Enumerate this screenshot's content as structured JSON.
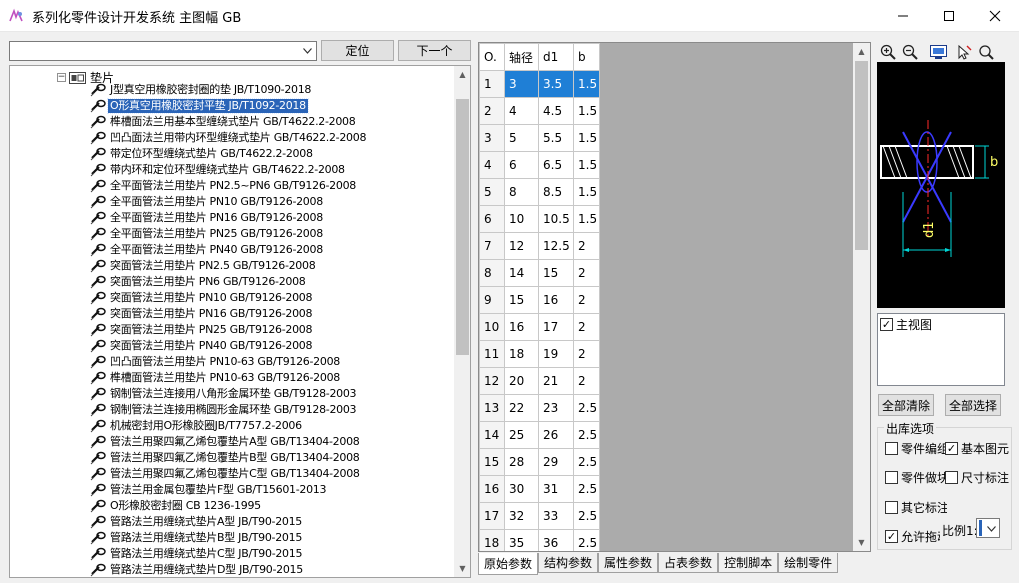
{
  "window": {
    "title": "系列化零件设计开发系统 主图幅 GB"
  },
  "search": {
    "value": "",
    "locate_label": "定位",
    "next_label": "下一个"
  },
  "tree": {
    "root_label": "垫片",
    "items": [
      "J型真空用橡胶密封圈的垫 JB/T1090-2018",
      "O形真空用橡胶密封平垫 JB/T1092-2018",
      "榫槽面法兰用基本型缠绕式垫片 GB/T4622.2-2008",
      "凹凸面法兰用带内环型缠绕式垫片 GB/T4622.2-2008",
      "带定位环型缠绕式垫片 GB/T4622.2-2008",
      "带内环和定位环型缠绕式垫片 GB/T4622.2-2008",
      "全平面管法兰用垫片 PN2.5~PN6  GB/T9126-2008",
      "全平面管法兰用垫片 PN10 GB/T9126-2008",
      "全平面管法兰用垫片 PN16 GB/T9126-2008",
      "全平面管法兰用垫片 PN25  GB/T9126-2008",
      "全平面管法兰用垫片 PN40  GB/T9126-2008",
      "突面管法兰用垫片 PN2.5  GB/T9126-2008",
      "突面管法兰用垫片 PN6 GB/T9126-2008",
      "突面管法兰用垫片 PN10  GB/T9126-2008",
      "突面管法兰用垫片 PN16  GB/T9126-2008",
      "突面管法兰用垫片 PN25 GB/T9126-2008",
      "突面管法兰用垫片 PN40 GB/T9126-2008",
      "凹凸面管法兰用垫片 PN10-63  GB/T9126-2008",
      "榫槽面管法兰用垫片 PN10-63 GB/T9126-2008",
      "钢制管法兰连接用八角形金属环垫 GB/T9128-2003",
      "钢制管法兰连接用椭圆形金属环垫 GB/T9128-2003",
      "机械密封用O形橡胶圈JB/T7757.2-2006",
      "管法兰用聚四氟乙烯包覆垫片A型  GB/T13404-2008",
      "管法兰用聚四氟乙烯包覆垫片B型  GB/T13404-2008",
      "管法兰用聚四氟乙烯包覆垫片C型  GB/T13404-2008",
      "管法兰用金属包覆垫片F型  GB/T15601-2013",
      "O形橡胶密封圈 CB 1236-1995",
      "管路法兰用缠绕式垫片A型 JB/T90-2015",
      "管路法兰用缠绕式垫片B型 JB/T90-2015",
      "管路法兰用缠绕式垫片C型 JB/T90-2015",
      "管路法兰用缠绕式垫片D型 JB/T90-2015"
    ]
  },
  "grid": {
    "headers": [
      "O.",
      "轴径",
      "d1",
      "b"
    ],
    "rows": [
      [
        "1",
        "3",
        "3.5",
        "1.5"
      ],
      [
        "2",
        "4",
        "4.5",
        "1.5"
      ],
      [
        "3",
        "5",
        "5.5",
        "1.5"
      ],
      [
        "4",
        "6",
        "6.5",
        "1.5"
      ],
      [
        "5",
        "8",
        "8.5",
        "1.5"
      ],
      [
        "6",
        "10",
        "10.5",
        "1.5"
      ],
      [
        "7",
        "12",
        "12.5",
        "2"
      ],
      [
        "8",
        "14",
        "15",
        "2"
      ],
      [
        "9",
        "15",
        "16",
        "2"
      ],
      [
        "10",
        "16",
        "17",
        "2"
      ],
      [
        "11",
        "18",
        "19",
        "2"
      ],
      [
        "12",
        "20",
        "21",
        "2"
      ],
      [
        "13",
        "22",
        "23",
        "2.5"
      ],
      [
        "14",
        "25",
        "26",
        "2.5"
      ],
      [
        "15",
        "28",
        "29",
        "2.5"
      ],
      [
        "16",
        "30",
        "31",
        "2.5"
      ],
      [
        "17",
        "32",
        "33",
        "2.5"
      ],
      [
        "18",
        "35",
        "36",
        "2.5"
      ]
    ]
  },
  "tabs": [
    "原始参数",
    "结构参数",
    "属性参数",
    "占表参数",
    "控制脚本",
    "绘制零件"
  ],
  "preview": {
    "dim_label": "d1",
    "dim_label_2": "b"
  },
  "views": {
    "items": [
      {
        "label": "主视图",
        "checked": true
      }
    ]
  },
  "buttons": {
    "clear_all": "全部清除",
    "select_all": "全部选择"
  },
  "output_options": {
    "legend": "出库选项",
    "items": [
      {
        "label": "零件编组",
        "checked": false
      },
      {
        "label": "基本图元",
        "checked": true
      },
      {
        "label": "零件做块",
        "checked": false
      },
      {
        "label": "尺寸标注",
        "checked": false
      },
      {
        "label": "其它标注",
        "checked": false
      },
      {
        "label": "允许拖动",
        "checked": true
      }
    ],
    "scale_label": "比例1:",
    "scale_value": "1"
  },
  "colors": {
    "selection": "#1f7fd6",
    "tree_selection": "#2a64b8",
    "preview_bg": "#000000",
    "preview_line": "#ffffff",
    "dim_color": "#00d6d6",
    "center_color": "#ff2a2a",
    "cross_color": "#3a3aff",
    "label_color": "#ffff66"
  },
  "icons": [
    "app-icon",
    "minimize-icon",
    "maximize-icon",
    "close-icon",
    "dropdown-arrow-icon",
    "folder-icon",
    "part-icon",
    "zoom-in-icon",
    "zoom-out-icon",
    "screen-icon",
    "select-icon",
    "zoom-window-icon"
  ]
}
